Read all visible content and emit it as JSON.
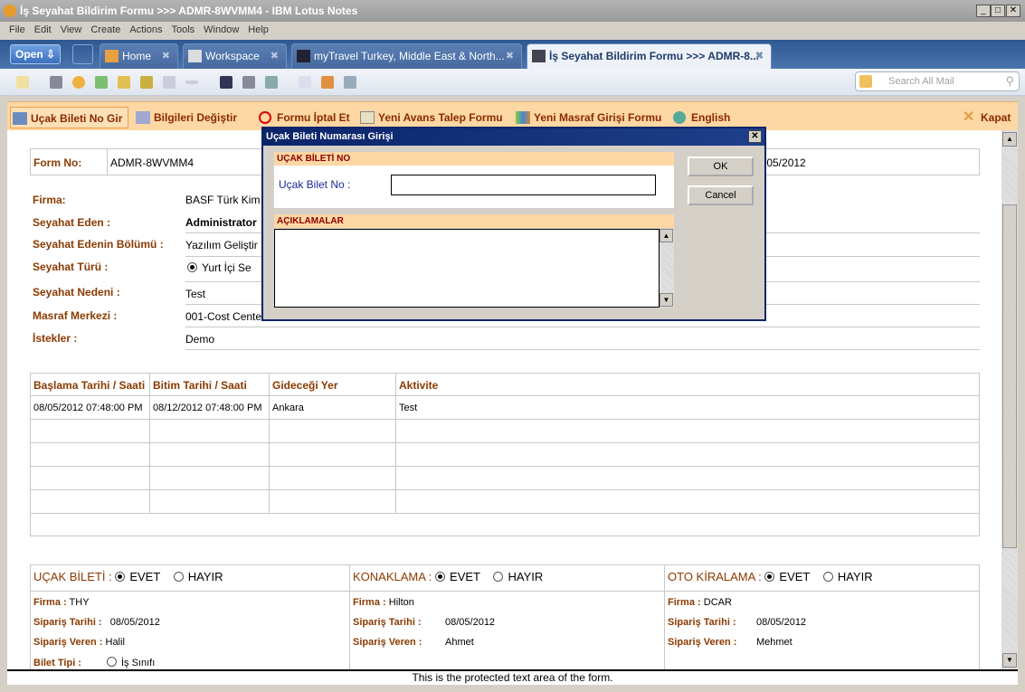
{
  "window": {
    "title": "İş Seyahat Bildirim Formu >>> ADMR-8WVMM4 - IBM Lotus Notes"
  },
  "menu": [
    "File",
    "Edit",
    "View",
    "Create",
    "Actions",
    "Tools",
    "Window",
    "Help"
  ],
  "tabs": {
    "open_label": "Open",
    "items": [
      {
        "label": "Home"
      },
      {
        "label": "Workspace"
      },
      {
        "label": "myTravel Turkey, Middle East & North..."
      },
      {
        "label": "İş Seyahat Bildirim Formu >>> ADMR-8..."
      }
    ]
  },
  "search": {
    "placeholder": "Search All Mail"
  },
  "actions": [
    {
      "label": "Uçak Bileti No Gir"
    },
    {
      "label": "Bilgileri Değiştir"
    },
    {
      "label": "Formu İptal Et"
    },
    {
      "label": "Yeni Avans Talep Formu"
    },
    {
      "label": "Yeni Masraf Girişi Formu"
    },
    {
      "label": "English"
    }
  ],
  "close_label": "Kapat",
  "form": {
    "form_no_label": "Form No:",
    "form_no": "ADMR-8WVMM4",
    "date_partial": "/05/2012",
    "fields": [
      {
        "label": "Firma:",
        "value": "BASF Türk Kim"
      },
      {
        "label": "Seyahat Eden :",
        "value": "Administrator"
      },
      {
        "label": "Seyahat Edenin Bölümü :",
        "value": "Yazılım Geliştir"
      },
      {
        "label": "Seyahat Türü :",
        "value": "Yurt İçi Se"
      },
      {
        "label": "Seyahat Nedeni :",
        "value": "Test"
      },
      {
        "label": "Masraf Merkezi :",
        "value": "001-Cost Cente"
      },
      {
        "label": "İstekler :",
        "value": "Demo"
      }
    ],
    "table": {
      "headers": [
        "Başlama Tarihi / Saati",
        "Bitim Tarihi / Saati",
        "Gideceği Yer",
        "Aktivite"
      ],
      "rows": [
        [
          "08/05/2012 07:48:00 PM",
          "08/12/2012 07:48:00 PM",
          "Ankara",
          "Test"
        ]
      ]
    },
    "sections": [
      {
        "title": "UÇAK BİLETİ :",
        "yes": "EVET",
        "no": "HAYIR",
        "lines": [
          {
            "label": "Firma :",
            "value": "THY"
          },
          {
            "label": "Sipariş Tarihi :",
            "value": "08/05/2012"
          },
          {
            "label": "Sipariş Veren :",
            "value": "Halil"
          },
          {
            "label": "Bilet Tipi :",
            "value": "İş Sınıfı"
          }
        ]
      },
      {
        "title": "KONAKLAMA :",
        "yes": "EVET",
        "no": "HAYIR",
        "lines": [
          {
            "label": "Firma :",
            "value": "Hilton"
          },
          {
            "label": "Sipariş Tarihi :",
            "value": "08/05/2012"
          },
          {
            "label": "Sipariş Veren :",
            "value": "Ahmet"
          }
        ]
      },
      {
        "title": "OTO KİRALAMA :",
        "yes": "EVET",
        "no": "HAYIR",
        "lines": [
          {
            "label": "Firma :",
            "value": "DCAR"
          },
          {
            "label": "Sipariş Tarihi :",
            "value": "08/05/2012"
          },
          {
            "label": "Sipariş Veren :",
            "value": "Mehmet"
          }
        ]
      }
    ]
  },
  "status": "This is the protected text area of the form.",
  "dialog": {
    "title": "Uçak Bileti Numarası Girişi",
    "section1": "UÇAK BİLETİ NO",
    "field_label": "Uçak Bilet No :",
    "field_value": "",
    "section2": "AÇIKLAMALAR",
    "notes": "",
    "ok": "OK",
    "cancel": "Cancel"
  },
  "colors": {
    "accent_label": "#8b3a00",
    "action_bar": "#fdd7a4",
    "tab_bar": "#3a64a0",
    "dialog_title": "#0a246a"
  }
}
